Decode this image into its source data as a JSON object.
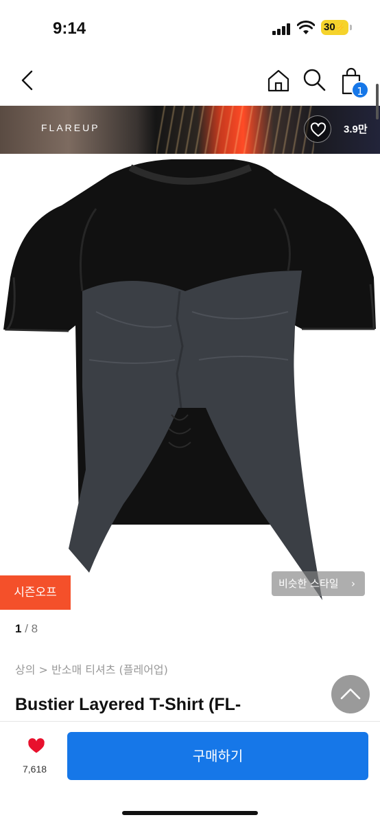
{
  "status_bar": {
    "time": "9:14",
    "battery": "30"
  },
  "nav": {
    "cart_count": "1"
  },
  "banner": {
    "brand": "FLAREUP",
    "like_count": "3.9만"
  },
  "product": {
    "season_tag": "시즌오프",
    "similar_style": "비슷한 스타일",
    "image_index": "1",
    "image_total": "/ 8",
    "breadcrumb": "상의 > 반소매 티셔츠 (플레어업)",
    "title": "Bustier Layered T-Shirt (FL-"
  },
  "bottom_bar": {
    "like_count": "7,618",
    "buy_label": "구매하기"
  },
  "colors": {
    "accent_blue": "#1677e8",
    "season_orange": "#f4502a",
    "heart_red": "#e8112d"
  },
  "icons": [
    "back-arrow-icon",
    "home-icon",
    "search-icon",
    "shopping-bag-icon",
    "heart-outline-icon",
    "chevron-right-icon",
    "chevron-up-icon",
    "heart-filled-icon"
  ]
}
